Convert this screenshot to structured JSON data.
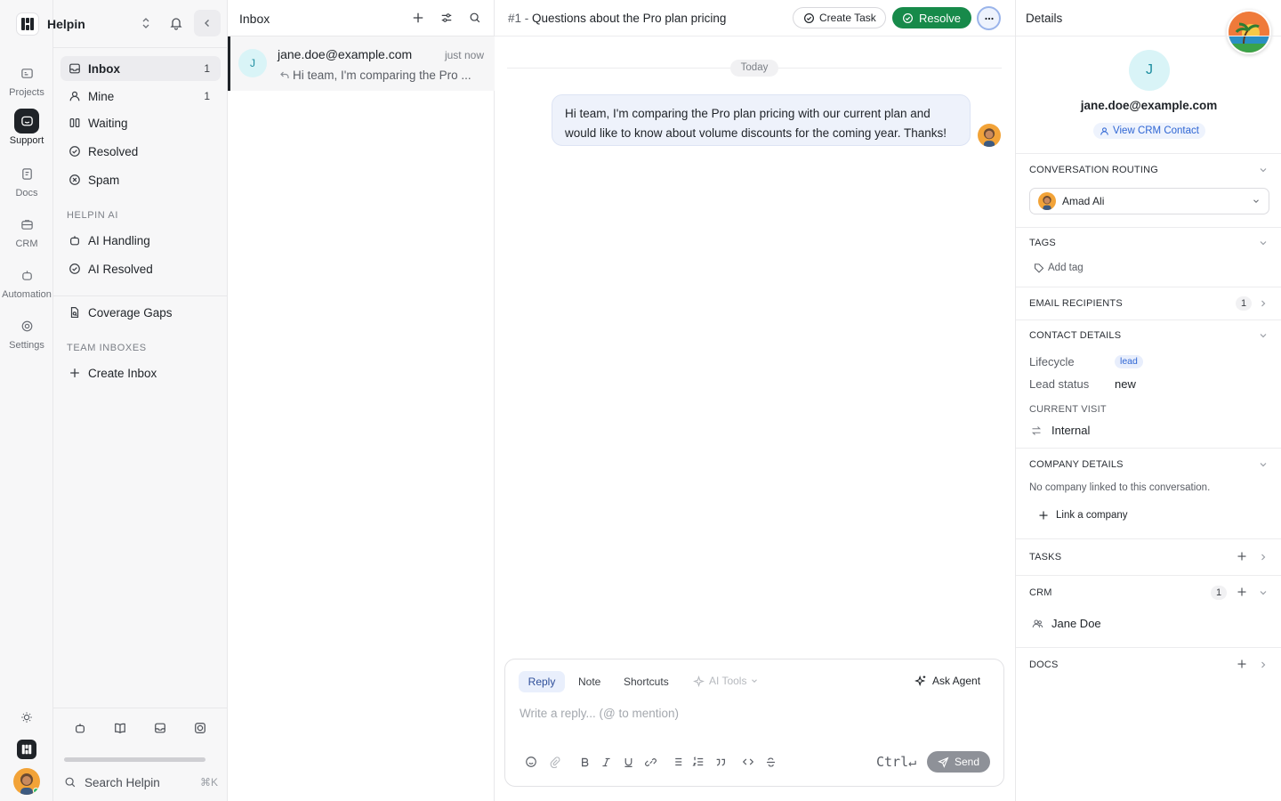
{
  "workspace": {
    "name": "Helpin"
  },
  "rail": {
    "items": [
      {
        "label": "Projects",
        "icon": "projects-icon"
      },
      {
        "label": "Support",
        "icon": "support-icon",
        "active": true
      },
      {
        "label": "Docs",
        "icon": "docs-icon"
      },
      {
        "label": "CRM",
        "icon": "crm-icon"
      },
      {
        "label": "Automation",
        "icon": "automation-icon"
      },
      {
        "label": "Settings",
        "icon": "settings-icon"
      }
    ]
  },
  "sidebar": {
    "items": [
      {
        "label": "Inbox",
        "count": "1",
        "icon": "inbox-icon",
        "active": true
      },
      {
        "label": "Mine",
        "count": "1",
        "icon": "user-icon"
      },
      {
        "label": "Waiting",
        "count": "",
        "icon": "waiting-icon"
      },
      {
        "label": "Resolved",
        "count": "",
        "icon": "check-circle-icon"
      },
      {
        "label": "Spam",
        "count": "",
        "icon": "x-circle-icon"
      }
    ],
    "ai_section": "HELPIN AI",
    "ai_items": [
      {
        "label": "AI Handling",
        "icon": "bot-icon"
      },
      {
        "label": "AI Resolved",
        "icon": "check-circle-icon"
      }
    ],
    "coverage": "Coverage Gaps",
    "team_section": "TEAM INBOXES",
    "create_inbox": "Create Inbox",
    "search_placeholder": "Search Helpin",
    "search_shortcut": "⌘K"
  },
  "inbox": {
    "title": "Inbox",
    "conversations": [
      {
        "avatar": "J",
        "from": "jane.doe@example.com",
        "time": "just now",
        "preview": "Hi team, I'm comparing the Pro ..."
      }
    ]
  },
  "conversation": {
    "number": "#1 -",
    "subject": "Questions about the Pro plan pricing",
    "create_task": "Create Task",
    "resolve": "Resolve",
    "date_divider": "Today",
    "message_line1": "Hi team, I'm comparing the Pro plan pricing with our current plan and",
    "message_line2": "would like to know about volume discounts for the coming year. Thanks!"
  },
  "composer": {
    "tabs": [
      "Reply",
      "Note",
      "Shortcuts"
    ],
    "ai_tools": "AI Tools",
    "ask_agent": "Ask Agent",
    "placeholder": "Write a reply... (@ to mention)",
    "shortcut": "Ctrl↵",
    "send": "Send"
  },
  "details": {
    "title": "Details",
    "contact_avatar": "J",
    "contact_email": "jane.doe@example.com",
    "view_crm": "View CRM Contact",
    "routing_title": "CONVERSATION ROUTING",
    "assignee": "Amad Ali",
    "tags_title": "TAGS",
    "add_tag": "Add tag",
    "recipients_title": "EMAIL RECIPIENTS",
    "recipients_count": "1",
    "contact_title": "CONTACT DETAILS",
    "lifecycle_label": "Lifecycle",
    "lifecycle_value": "lead",
    "lead_status_label": "Lead status",
    "lead_status_value": "new",
    "current_visit_label": "CURRENT VISIT",
    "current_visit_value": "Internal",
    "company_title": "COMPANY DETAILS",
    "company_empty": "No company linked to this conversation.",
    "link_company": "Link a company",
    "tasks_title": "TASKS",
    "crm_title": "CRM",
    "crm_count": "1",
    "crm_contact": "Jane Doe",
    "docs_title": "DOCS"
  },
  "colors": {
    "resolve_green": "#178a4a",
    "accent_blue": "#2f66d4",
    "avatar_cyan_bg": "#d9f4f7",
    "avatar_cyan_text": "#1e8ea0",
    "message_bg": "#eef2fb"
  }
}
